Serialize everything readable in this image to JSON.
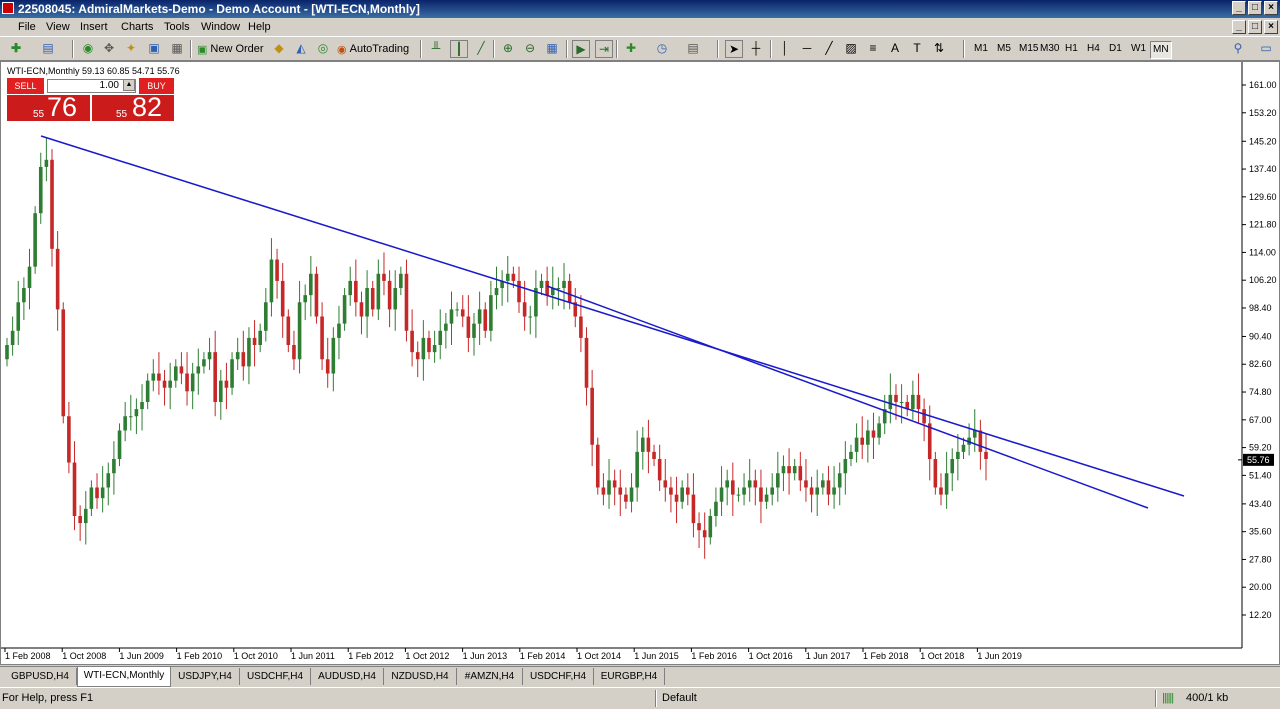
{
  "window": {
    "title": "22508045: AdmiralMarkets-Demo - Demo Account - [WTI-ECN,Monthly]"
  },
  "menu": [
    "File",
    "View",
    "Insert",
    "Charts",
    "Tools",
    "Window",
    "Help"
  ],
  "toolbar": {
    "new_order": "New Order",
    "autotrading": "AutoTrading",
    "timeframes": [
      "M1",
      "M5",
      "M15",
      "M30",
      "H1",
      "H4",
      "D1",
      "W1",
      "MN"
    ],
    "active_timeframe": "MN"
  },
  "chart": {
    "label": "WTI-ECN,Monthly  59.13 60.85 54.71 55.76",
    "current_price": "55.76",
    "trade_panel": {
      "sell_label": "SELL",
      "buy_label": "BUY",
      "lot": "1.00",
      "sell_small": "55",
      "sell_big": "76",
      "buy_small": "55",
      "buy_big": "82"
    }
  },
  "chart_data": {
    "type": "candlestick",
    "symbol": "WTI-ECN",
    "timeframe": "Monthly",
    "ohlc_last": {
      "open": 59.13,
      "high": 60.85,
      "low": 54.71,
      "close": 55.76
    },
    "y_ticks": [
      "161.00",
      "153.20",
      "145.20",
      "137.40",
      "129.60",
      "121.80",
      "114.00",
      "106.20",
      "98.40",
      "90.40",
      "82.60",
      "74.80",
      "67.00",
      "59.20",
      "51.40",
      "43.40",
      "35.60",
      "27.80",
      "20.00",
      "12.20"
    ],
    "x_ticks": [
      "1 Feb 2008",
      "1 Oct 2008",
      "1 Jun 2009",
      "1 Feb 2010",
      "1 Oct 2010",
      "1 Jun 2011",
      "1 Feb 2012",
      "1 Oct 2012",
      "1 Jun 2013",
      "1 Feb 2014",
      "1 Oct 2014",
      "1 Jun 2015",
      "1 Feb 2016",
      "1 Oct 2016",
      "1 Jun 2017",
      "1 Feb 2018",
      "1 Oct 2018",
      "1 Jun 2019"
    ],
    "ylim": [
      12.2,
      161.0
    ],
    "close_path": [
      88,
      92,
      100,
      104,
      110,
      125,
      138,
      140,
      115,
      98,
      68,
      55,
      40,
      38,
      42,
      48,
      45,
      48,
      52,
      56,
      64,
      68,
      68,
      70,
      72,
      78,
      80,
      78,
      76,
      78,
      82,
      80,
      75,
      80,
      82,
      84,
      86,
      72,
      78,
      76,
      84,
      86,
      82,
      90,
      88,
      92,
      100,
      112,
      106,
      96,
      88,
      84,
      100,
      102,
      108,
      96,
      84,
      80,
      90,
      94,
      102,
      106,
      100,
      96,
      104,
      98,
      108,
      106,
      98,
      104,
      108,
      92,
      86,
      84,
      90,
      86,
      88,
      92,
      94,
      98,
      98,
      96,
      90,
      94,
      98,
      92,
      102,
      104,
      106,
      108,
      106,
      100,
      96,
      96,
      104,
      106,
      102,
      104,
      104,
      106,
      100,
      96,
      90,
      76,
      60,
      48,
      46,
      50,
      48,
      46,
      44,
      48,
      58,
      62,
      58,
      56,
      50,
      48,
      46,
      44,
      48,
      46,
      38,
      36,
      34,
      40,
      44,
      48,
      50,
      46,
      46,
      48,
      50,
      48,
      44,
      46,
      48,
      52,
      54,
      52,
      54,
      50,
      48,
      46,
      48,
      50,
      46,
      48,
      52,
      56,
      58,
      62,
      60,
      64,
      62,
      66,
      70,
      74,
      72,
      72,
      70,
      74,
      70,
      66,
      56,
      48,
      46,
      52,
      56,
      58,
      60,
      62,
      64,
      58,
      56
    ]
  },
  "tabs": [
    "GBPUSD,H4",
    "WTI-ECN,Monthly",
    "USDJPY,H4",
    "USDCHF,H4",
    "AUDUSD,H4",
    "NZDUSD,H4",
    "#AMZN,H4",
    "USDCHF,H4",
    "EURGBP,H4"
  ],
  "active_tab": "WTI-ECN,Monthly",
  "status": {
    "help": "For Help, press F1",
    "profile": "Default",
    "traffic": "400/1 kb"
  }
}
